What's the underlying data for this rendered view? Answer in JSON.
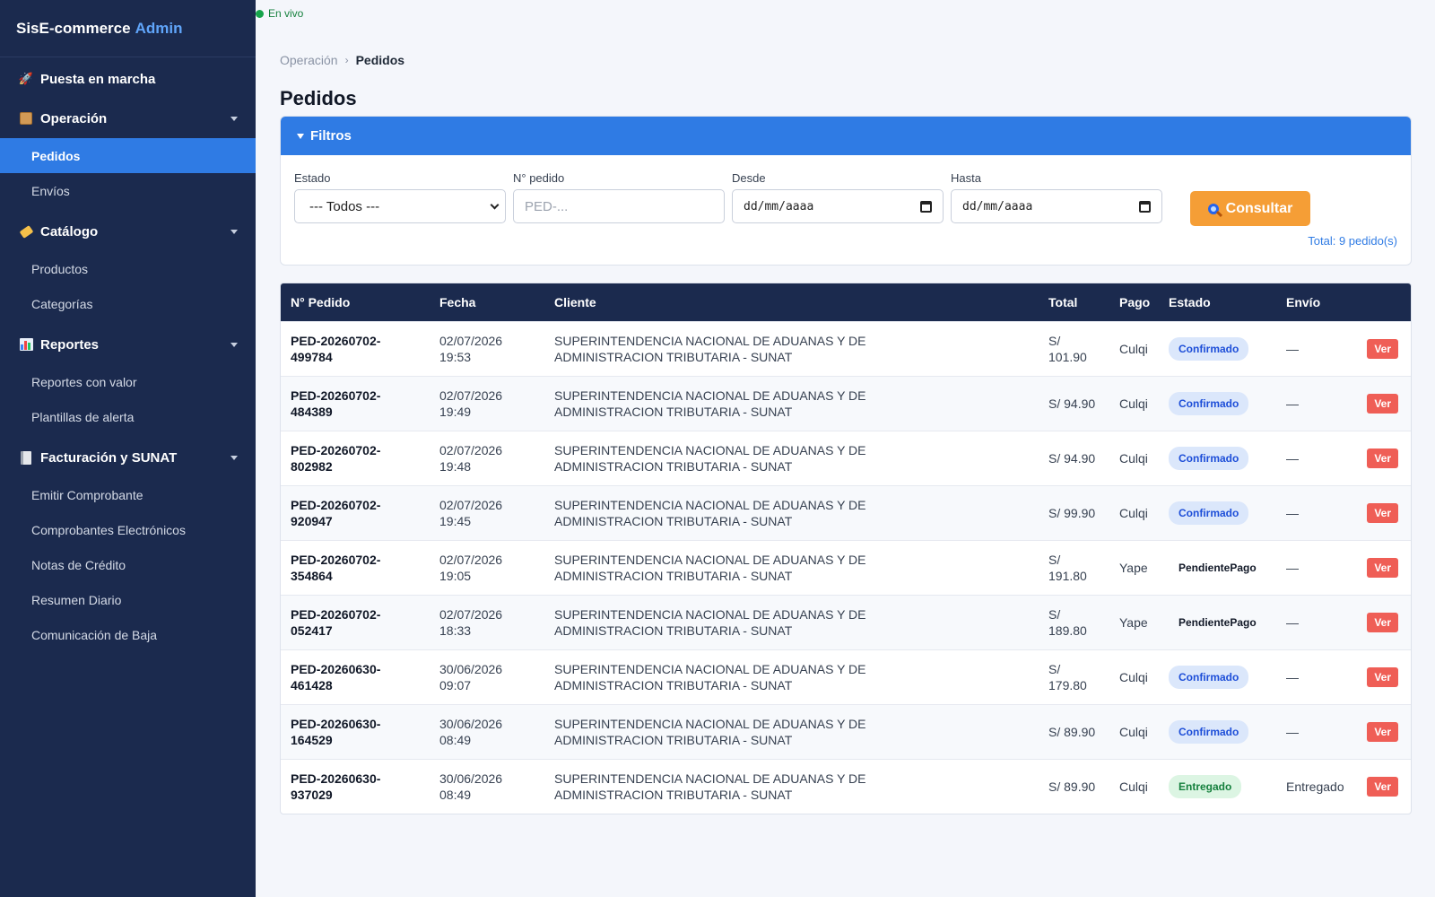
{
  "app": {
    "brand_main": "SisE-commerce",
    "brand_accent": "Admin"
  },
  "status": {
    "live_label": "En vivo"
  },
  "sidebar": {
    "start": {
      "label": "Puesta en marcha",
      "icon": "rocket-icon"
    },
    "groups": [
      {
        "label": "Operación",
        "icon": "box-icon",
        "items": [
          "Pedidos",
          "Envíos"
        ]
      },
      {
        "label": "Catálogo",
        "icon": "tag-icon",
        "items": [
          "Productos",
          "Categorías"
        ]
      },
      {
        "label": "Reportes",
        "icon": "bar-chart-icon",
        "items": [
          "Reportes con valor",
          "Plantillas de alerta"
        ]
      },
      {
        "label": "Facturación y SUNAT",
        "icon": "receipt-icon",
        "items": [
          "Emitir Comprobante",
          "Comprobantes Electrónicos",
          "Notas de Crédito",
          "Resumen Diario",
          "Comunicación de Baja"
        ]
      }
    ],
    "active_item": "Pedidos"
  },
  "breadcrumb": {
    "parent": "Operación",
    "separator": "›",
    "current": "Pedidos"
  },
  "page": {
    "title": "Pedidos"
  },
  "filters": {
    "title": "Filtros",
    "estado": {
      "label": "Estado",
      "value": "--- Todos ---"
    },
    "pedido": {
      "label": "N° pedido",
      "placeholder": "PED-..."
    },
    "desde": {
      "label": "Desde",
      "value": "dd/mm/aaaa"
    },
    "hasta": {
      "label": "Hasta",
      "value": "dd/mm/aaaa"
    },
    "submit_label": "Consultar",
    "total_text": "Total: 9 pedido(s)"
  },
  "table": {
    "headers": [
      "N° Pedido",
      "Fecha",
      "Cliente",
      "Total",
      "Pago",
      "Estado",
      "Envío",
      ""
    ],
    "view_label": "Ver",
    "rows": [
      {
        "id": "PED-20260702-499784",
        "fecha": "02/07/2026 19:53",
        "cliente": "SUPERINTENDENCIA NACIONAL DE ADUANAS Y DE ADMINISTRACION TRIBUTARIA - SUNAT",
        "total": "S/ 101.90",
        "pago": "Culqi",
        "estado": "Confirmado",
        "envio": "—"
      },
      {
        "id": "PED-20260702-484389",
        "fecha": "02/07/2026 19:49",
        "cliente": "SUPERINTENDENCIA NACIONAL DE ADUANAS Y DE ADMINISTRACION TRIBUTARIA - SUNAT",
        "total": "S/ 94.90",
        "pago": "Culqi",
        "estado": "Confirmado",
        "envio": "—"
      },
      {
        "id": "PED-20260702-802982",
        "fecha": "02/07/2026 19:48",
        "cliente": "SUPERINTENDENCIA NACIONAL DE ADUANAS Y DE ADMINISTRACION TRIBUTARIA - SUNAT",
        "total": "S/ 94.90",
        "pago": "Culqi",
        "estado": "Confirmado",
        "envio": "—"
      },
      {
        "id": "PED-20260702-920947",
        "fecha": "02/07/2026 19:45",
        "cliente": "SUPERINTENDENCIA NACIONAL DE ADUANAS Y DE ADMINISTRACION TRIBUTARIA - SUNAT",
        "total": "S/ 99.90",
        "pago": "Culqi",
        "estado": "Confirmado",
        "envio": "—"
      },
      {
        "id": "PED-20260702-354864",
        "fecha": "02/07/2026 19:05",
        "cliente": "SUPERINTENDENCIA NACIONAL DE ADUANAS Y DE ADMINISTRACION TRIBUTARIA - SUNAT",
        "total": "S/ 191.80",
        "pago": "Yape",
        "estado": "PendientePago",
        "envio": "—"
      },
      {
        "id": "PED-20260702-052417",
        "fecha": "02/07/2026 18:33",
        "cliente": "SUPERINTENDENCIA NACIONAL DE ADUANAS Y DE ADMINISTRACION TRIBUTARIA - SUNAT",
        "total": "S/ 189.80",
        "pago": "Yape",
        "estado": "PendientePago",
        "envio": "—"
      },
      {
        "id": "PED-20260630-461428",
        "fecha": "30/06/2026 09:07",
        "cliente": "SUPERINTENDENCIA NACIONAL DE ADUANAS Y DE ADMINISTRACION TRIBUTARIA - SUNAT",
        "total": "S/ 179.80",
        "pago": "Culqi",
        "estado": "Confirmado",
        "envio": "—"
      },
      {
        "id": "PED-20260630-164529",
        "fecha": "30/06/2026 08:49",
        "cliente": "SUPERINTENDENCIA NACIONAL DE ADUANAS Y DE ADMINISTRACION TRIBUTARIA - SUNAT",
        "total": "S/ 89.90",
        "pago": "Culqi",
        "estado": "Confirmado",
        "envio": "—"
      },
      {
        "id": "PED-20260630-937029",
        "fecha": "30/06/2026 08:49",
        "cliente": "SUPERINTENDENCIA NACIONAL DE ADUANAS Y DE ADMINISTRACION TRIBUTARIA - SUNAT",
        "total": "S/ 89.90",
        "pago": "Culqi",
        "estado": "Entregado",
        "envio": "Entregado"
      }
    ]
  },
  "colors": {
    "sidebar_bg": "#1b2a4e",
    "accent": "#2f7be4",
    "button": "#f59e36",
    "danger": "#ef5e56"
  }
}
